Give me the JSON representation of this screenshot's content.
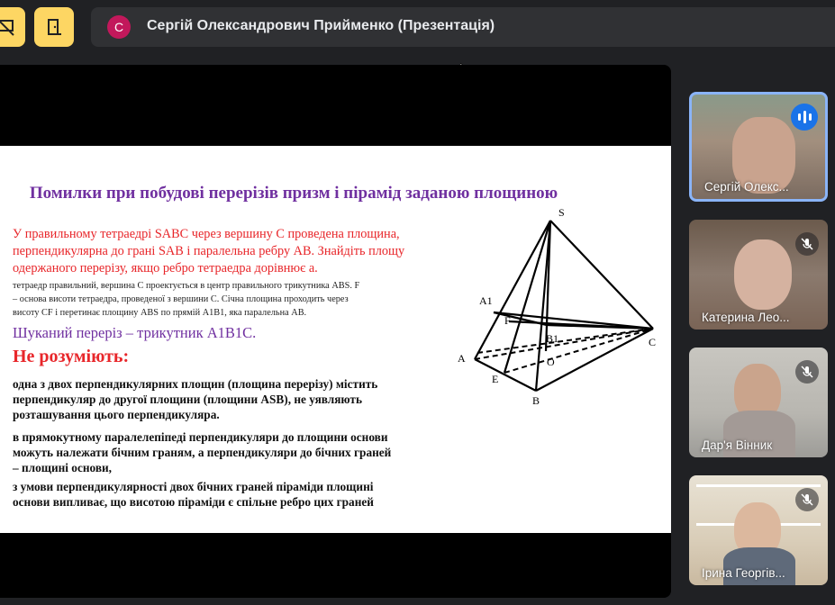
{
  "topbar": {
    "stop_present_icon": "present-off-icon",
    "leave_icon": "door-exit-icon",
    "presenter_initial": "С",
    "presenter_title": "Сергій Олександрович Прийменко (Презентація)",
    "accent": "#fdd663"
  },
  "slide": {
    "title": "Помилки при побудові перерізів призм і пірамід заданою площиною",
    "task_lines": [
      "У правильному тетраедрі SABC через вершину C проведена площина,",
      "перпендикулярна до грані SAB і паралельна ребру AB. Знайдіть площу",
      "одержаного перерізу, якщо ребро тетраедра дорівнює a."
    ],
    "note_lines": [
      "тетраедр правильний, вершина C проектується в центр правильного трикутника ABS. F",
      "– основа висоти тетраедра, проведеної з вершини C. Січна площина проходить через",
      "висоту CF і перетинає площину ABS по прямій A1B1, яка паралельна AB."
    ],
    "answer": "Шуканий переріз – трикутник A1B1C.",
    "subhead": "Не розуміють:",
    "para1": [
      "одна з двох перпендикулярних площин (площина перерізу) містить",
      "перпендикуляр до другої площини (площини ASB), не уявляють",
      "розташування цього перпендикуляра."
    ],
    "para2": [
      "в прямокутному паралелепіпеді перпендикуляри до площини основи",
      "можуть належати бічним граням, а перпендикуляри до бічних граней",
      "– площині основи,"
    ],
    "para3": [
      "з умови перпендикулярності двох бічних граней піраміди площині",
      "основи випливає, що висотою піраміди є спільне ребро цих граней"
    ],
    "figure_labels": {
      "S": "S",
      "A1": "A1",
      "F": "F",
      "B1": "B1",
      "C": "C",
      "A": "A",
      "E": "E",
      "O": "O",
      "B": "B"
    }
  },
  "participants": [
    {
      "name": "Сергій Олекс...",
      "mic": "speaking"
    },
    {
      "name": "Катерина Лео...",
      "mic": "muted"
    },
    {
      "name": "Дар'я Вінник",
      "mic": "muted"
    },
    {
      "name": "Ірина Георгів...",
      "mic": "muted"
    }
  ]
}
